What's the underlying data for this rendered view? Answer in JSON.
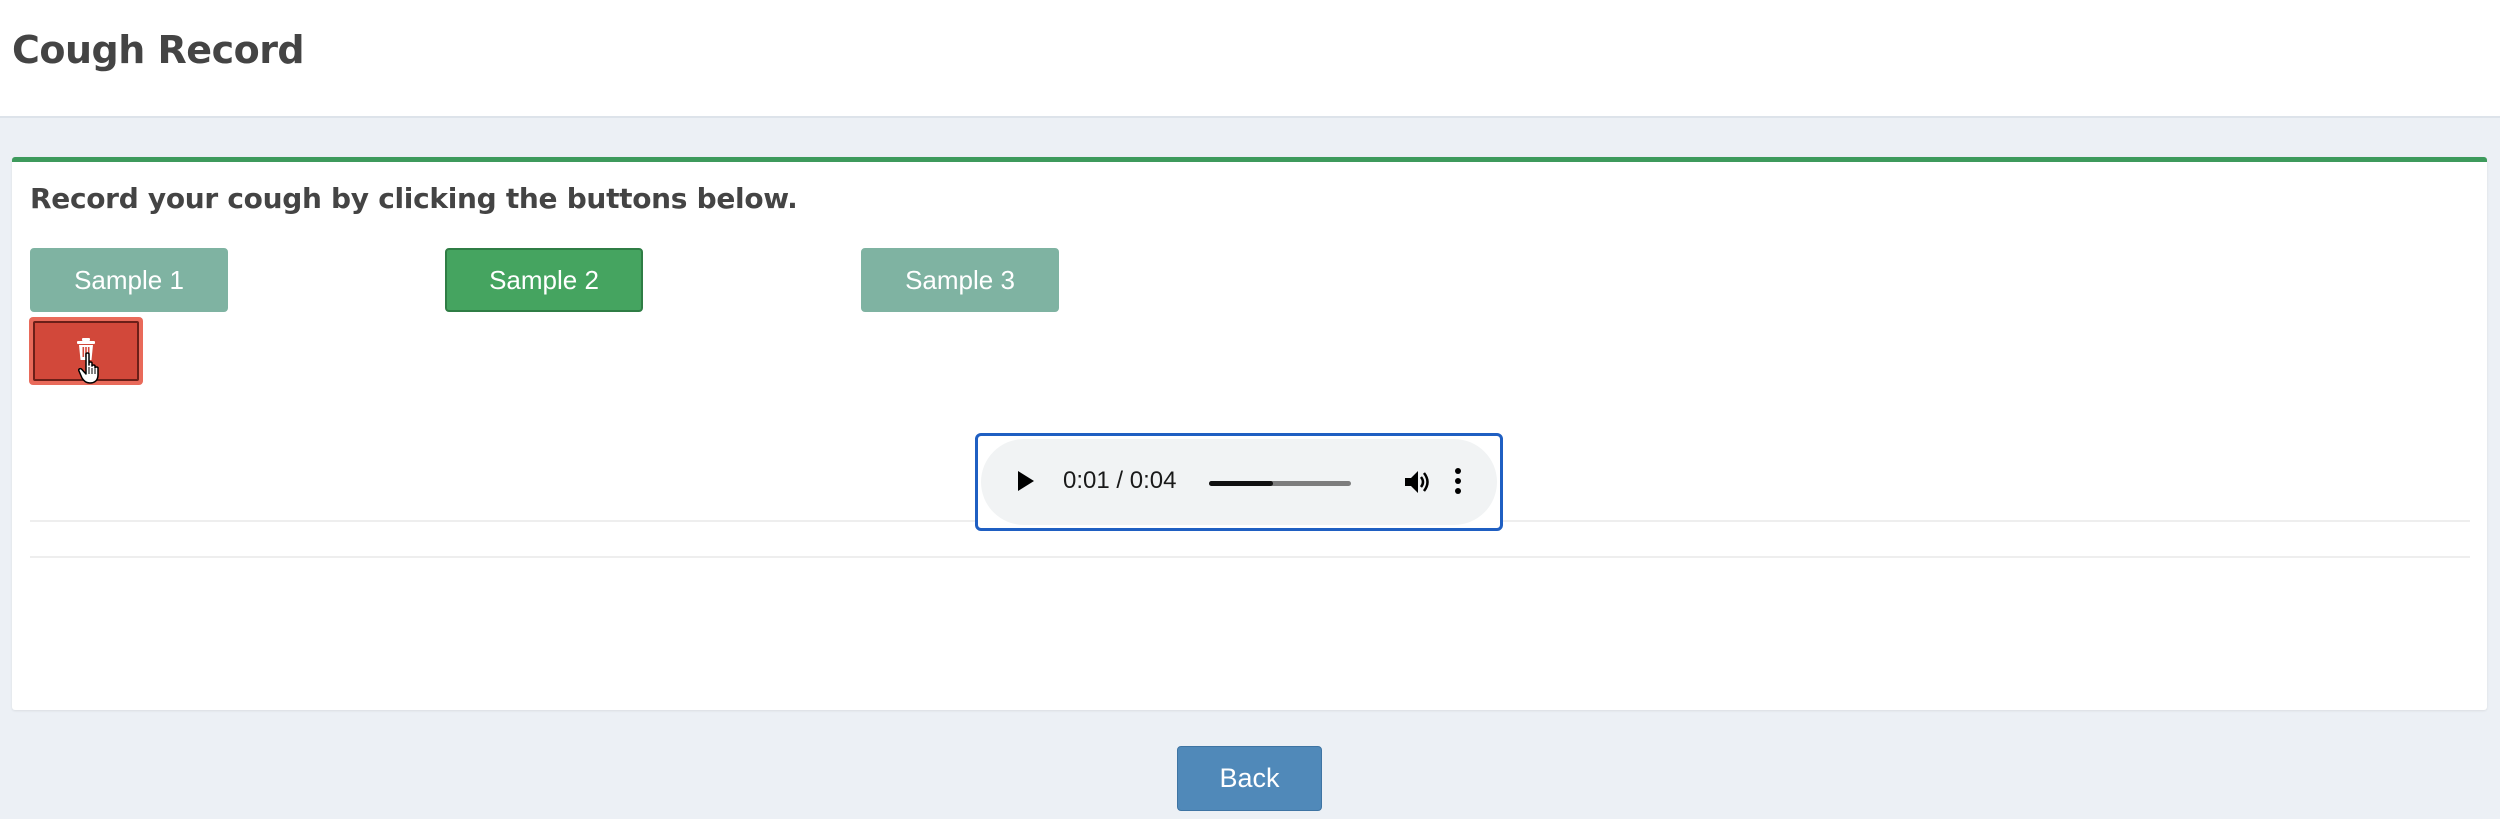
{
  "header": {
    "title": "Cough Record"
  },
  "record_box": {
    "instruction": "Record your cough by clicking the buttons below.",
    "samples": [
      {
        "label": "Sample 1",
        "state": "faded"
      },
      {
        "label": "Sample 2",
        "state": "active"
      },
      {
        "label": "Sample 3",
        "state": "faded"
      }
    ],
    "delete_icon": "trash-icon"
  },
  "audio_player": {
    "time_display": "0:01 / 0:04",
    "progress": 0.45,
    "icons": [
      "play-icon",
      "volume-icon",
      "more-options-icon"
    ]
  },
  "footer": {
    "back_label": "Back"
  },
  "colors": {
    "box_accent": "#3d9a5c",
    "sample_active": "#45a460",
    "sample_faded": "#7fb3a2",
    "delete": "#d2483a",
    "back": "#5089b9"
  }
}
